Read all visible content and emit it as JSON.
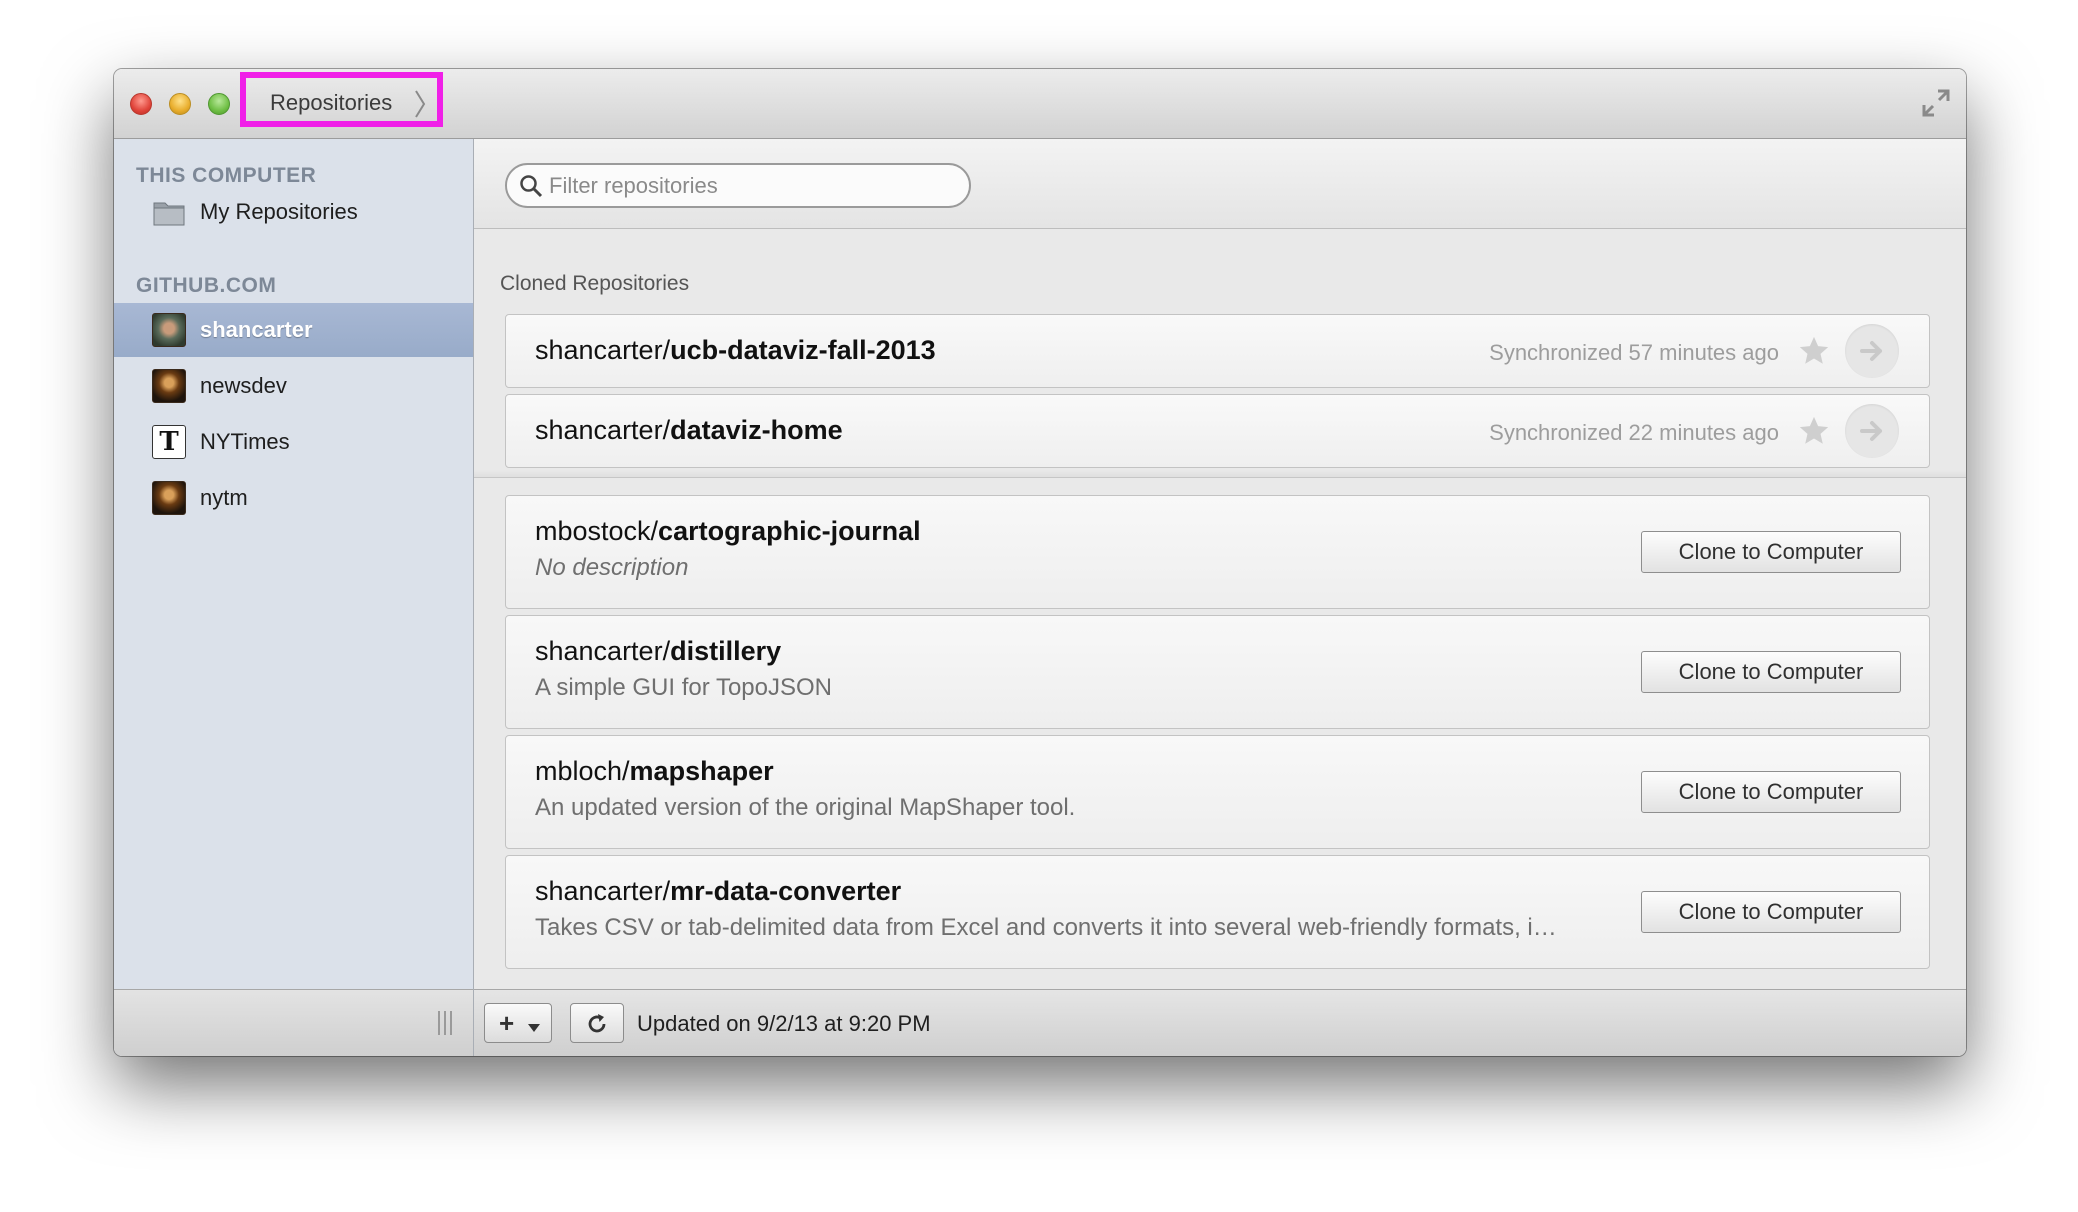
{
  "window": {
    "breadcrumb": "Repositories"
  },
  "sidebar": {
    "sections": [
      {
        "heading": "THIS COMPUTER",
        "items": [
          {
            "label": "My Repositories",
            "icon": "folder-icon"
          }
        ]
      },
      {
        "heading": "GITHUB.COM",
        "items": [
          {
            "label": "shancarter",
            "icon": "avatar",
            "selected": true
          },
          {
            "label": "newsdev",
            "icon": "avatar"
          },
          {
            "label": "NYTimes",
            "icon": "nyt-logo-icon"
          },
          {
            "label": "nytm",
            "icon": "avatar"
          }
        ]
      }
    ]
  },
  "search": {
    "placeholder": "Filter repositories",
    "value": ""
  },
  "cloned": {
    "heading": "Cloned Repositories",
    "repos": [
      {
        "owner": "shancarter/",
        "name": "ucb-dataviz-fall-2013",
        "status": "Synchronized 57 minutes ago"
      },
      {
        "owner": "shancarter/",
        "name": "dataviz-home",
        "status": "Synchronized 22 minutes ago"
      }
    ]
  },
  "remote": {
    "button_label": "Clone to Computer",
    "repos": [
      {
        "owner": "mbostock/",
        "name": "cartographic-journal",
        "description": "No description"
      },
      {
        "owner": "shancarter/",
        "name": "distillery",
        "description": "A simple GUI for TopoJSON"
      },
      {
        "owner": "mbloch/",
        "name": "mapshaper",
        "description": "An updated version of the original MapShaper tool."
      },
      {
        "owner": "shancarter/",
        "name": "mr-data-converter",
        "description": "Takes CSV or tab-delimited data from Excel and converts it into several web-friendly formats, i…"
      }
    ]
  },
  "footer": {
    "add_label": "+",
    "updated_text": "Updated on 9/2/13 at 9:20 PM"
  },
  "colors": {
    "highlight_border": "#f020e8",
    "sidebar_bg": "#dbe1ea",
    "sidebar_selected": "#a8b8d4"
  }
}
